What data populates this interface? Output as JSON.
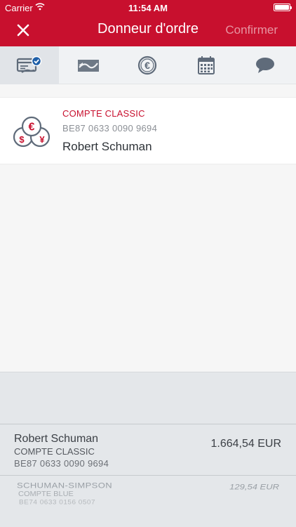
{
  "status_bar": {
    "carrier": "Carrier",
    "time": "11:54 AM",
    "battery_level": 1.0
  },
  "nav": {
    "title": "Donneur d'ordre",
    "confirm_label": "Confirmer",
    "close_icon": "close-icon"
  },
  "tabs": [
    {
      "icon": "account-check-icon",
      "active": true
    },
    {
      "icon": "transfer-icon",
      "active": false
    },
    {
      "icon": "euro-icon",
      "active": false
    },
    {
      "icon": "calendar-icon",
      "active": false
    },
    {
      "icon": "message-icon",
      "active": false
    }
  ],
  "selected_account": {
    "icon": "currency-coins-icon",
    "type": "COMPTE CLASSIC",
    "iban": "BE87 0633 0090 9694",
    "owner": "Robert Schuman"
  },
  "picker": {
    "items": [
      {
        "name": "Robert Schuman",
        "type": "COMPTE CLASSIC",
        "iban": "BE87 0633 0090 9694",
        "amount": "1.664,54 EUR"
      },
      {
        "name": "SCHUMAN-SIMPSON",
        "type": "COMPTE BLUE",
        "iban": "BE74 0633 0156 0507",
        "amount": "129,54 EUR"
      }
    ]
  },
  "colors": {
    "brand": "#c8102e",
    "tab_icon": "#5f6b7a",
    "accent_blue": "#1f5fa8"
  }
}
